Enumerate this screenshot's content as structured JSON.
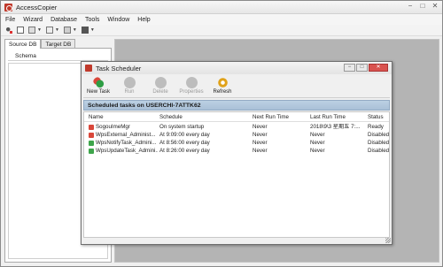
{
  "app": {
    "title": "AccessCopier"
  },
  "window_buttons": [
    "−",
    "□",
    "✕"
  ],
  "menu": [
    "File",
    "Wizard",
    "Database",
    "Tools",
    "Window",
    "Help"
  ],
  "left_panel": {
    "tabs": [
      "Source DB",
      "Target DB"
    ],
    "active_tab": "Source DB",
    "schema_header": "Schema"
  },
  "dialog": {
    "title": "Task Scheduler",
    "toolbar": [
      {
        "label": "New Task",
        "icon": "new-task-icon",
        "enabled": true,
        "color": "#2e9d44"
      },
      {
        "label": "Run",
        "icon": "run-icon",
        "enabled": false,
        "color": "#b9b9b9"
      },
      {
        "label": "Delete",
        "icon": "delete-icon",
        "enabled": false,
        "color": "#b9b9b9"
      },
      {
        "label": "Properties",
        "icon": "properties-icon",
        "enabled": false,
        "color": "#b9b9b9"
      },
      {
        "label": "Refresh",
        "icon": "refresh-icon",
        "enabled": true,
        "color": "#e0a21a"
      }
    ],
    "group_header": "Scheduled tasks on USERCHI-7ATTK62",
    "columns": [
      "Name",
      "Schedule",
      "Next Run Time",
      "Last Run Time",
      "Status"
    ],
    "rows": [
      {
        "name": "SogouImeMgr",
        "schedule": "On system startup",
        "next": "Never",
        "last": "2018\\9\\3 星期五 7:...",
        "status": "Ready",
        "icon_color": "#d9473a"
      },
      {
        "name": "WpsExternal_Administ...",
        "schedule": "At 9:09:00 every day",
        "next": "Never",
        "last": "Never",
        "status": "Disabled",
        "icon_color": "#d9473a"
      },
      {
        "name": "WpsNotifyTask_Admini...",
        "schedule": "At 8:56:00 every day",
        "next": "Never",
        "last": "Never",
        "status": "Disabled",
        "icon_color": "#3ea54b"
      },
      {
        "name": "WpsUpdateTask_Admini...",
        "schedule": "At 8:26:00 every day",
        "next": "Never",
        "last": "Never",
        "status": "Disabled",
        "icon_color": "#3ea54b"
      }
    ]
  }
}
